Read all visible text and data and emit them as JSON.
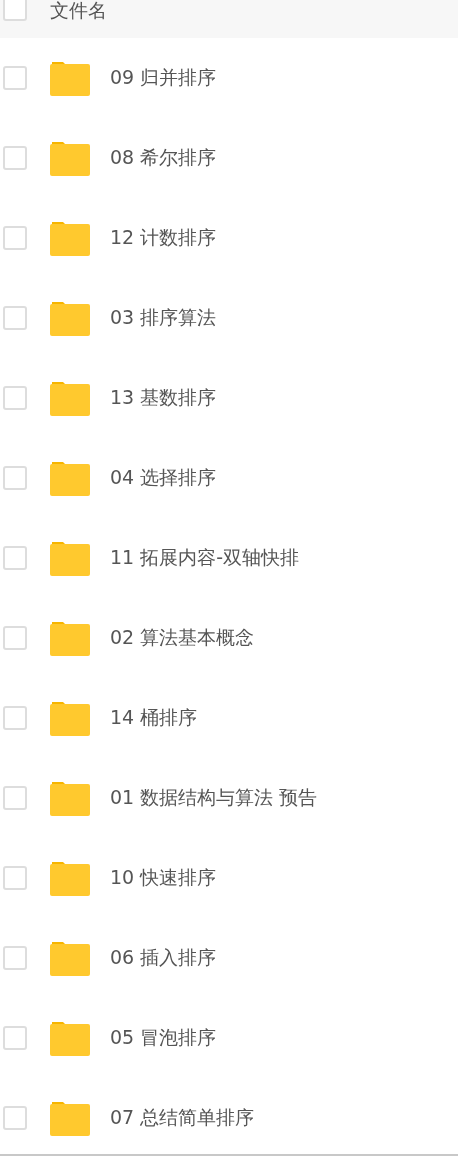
{
  "header": {
    "label": "文件名",
    "checked": false
  },
  "files": [
    {
      "name": "09 归并排序",
      "checked": false
    },
    {
      "name": "08 希尔排序",
      "checked": false
    },
    {
      "name": "12 计数排序",
      "checked": false
    },
    {
      "name": "03 排序算法",
      "checked": false
    },
    {
      "name": "13 基数排序",
      "checked": false
    },
    {
      "name": "04 选择排序",
      "checked": false
    },
    {
      "name": "11 拓展内容-双轴快排",
      "checked": false
    },
    {
      "name": "02 算法基本概念",
      "checked": false
    },
    {
      "name": "14 桶排序",
      "checked": false
    },
    {
      "name": "01 数据结构与算法 预告",
      "checked": false
    },
    {
      "name": "10 快速排序",
      "checked": false
    },
    {
      "name": "06 插入排序",
      "checked": false
    },
    {
      "name": "05 冒泡排序",
      "checked": false
    },
    {
      "name": "07 总结简单排序",
      "checked": false
    }
  ]
}
